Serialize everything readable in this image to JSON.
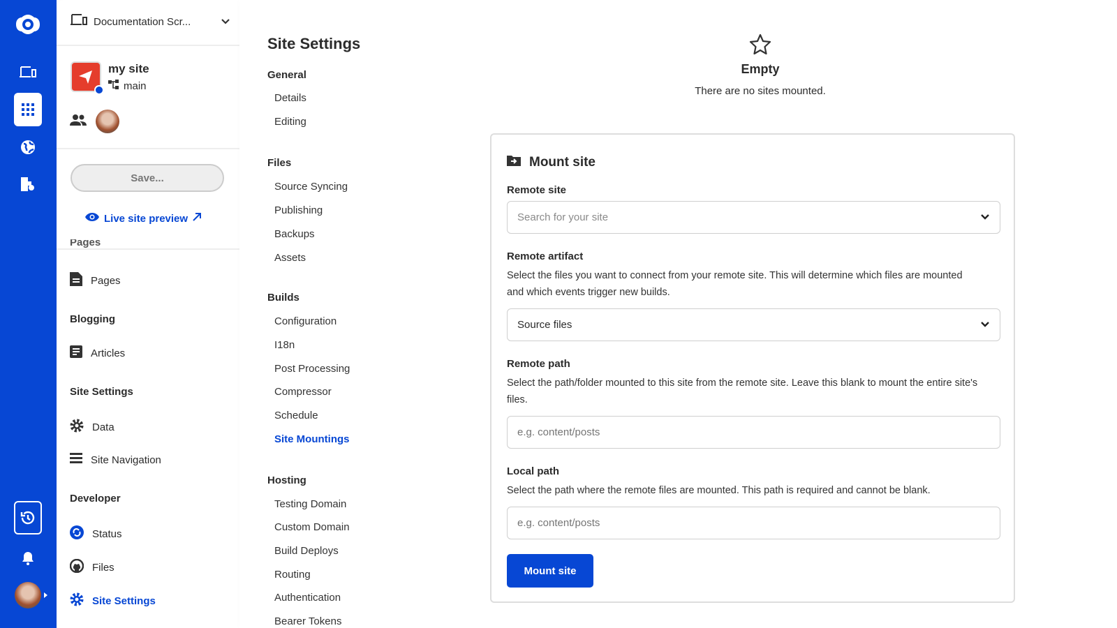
{
  "rail": {
    "brand": "#0747d4"
  },
  "project": {
    "name": "Documentation Scr..."
  },
  "site": {
    "name": "my site",
    "branch": "main"
  },
  "buttons": {
    "save": "Save...",
    "live_preview": "Live site preview"
  },
  "sidebar": {
    "cut_heading": "Pages",
    "sections": [
      {
        "heading": "",
        "items": [
          {
            "label": "Pages",
            "icon": "document-icon"
          }
        ]
      },
      {
        "heading": "Blogging",
        "items": [
          {
            "label": "Articles",
            "icon": "article-icon"
          }
        ]
      },
      {
        "heading": "Site Settings",
        "items": [
          {
            "label": "Data",
            "icon": "gear-icon"
          },
          {
            "label": "Site Navigation",
            "icon": "menu-icon"
          }
        ]
      },
      {
        "heading": "Developer",
        "items": [
          {
            "label": "Status",
            "icon": "sync-icon"
          },
          {
            "label": "Files",
            "icon": "github-icon"
          },
          {
            "label": "Site Settings",
            "icon": "gear-icon",
            "active": true
          }
        ]
      }
    ]
  },
  "settings_nav": {
    "title": "Site Settings",
    "groups": [
      {
        "heading": "General",
        "items": [
          "Details",
          "Editing"
        ]
      },
      {
        "heading": "Files",
        "items": [
          "Source Syncing",
          "Publishing",
          "Backups",
          "Assets"
        ]
      },
      {
        "heading": "Builds",
        "items": [
          "Configuration",
          "I18n",
          "Post Processing",
          "Compressor",
          "Schedule",
          "Site Mountings"
        ]
      },
      {
        "heading": "Hosting",
        "items": [
          "Testing Domain",
          "Custom Domain",
          "Build Deploys",
          "Routing",
          "Authentication",
          "Bearer Tokens"
        ]
      }
    ],
    "active": "Site Mountings"
  },
  "empty": {
    "title": "Empty",
    "text": "There are no sites mounted."
  },
  "form": {
    "title": "Mount site",
    "remote_site": {
      "label": "Remote site",
      "placeholder": "Search for your site"
    },
    "remote_artifact": {
      "label": "Remote artifact",
      "desc": "Select the files you want to connect from your remote site. This will determine which files are mounted and which events trigger new builds.",
      "value": "Source files"
    },
    "remote_path": {
      "label": "Remote path",
      "desc": "Select the path/folder mounted to this site from the remote site. Leave this blank to mount the entire site's files.",
      "placeholder": "e.g. content/posts"
    },
    "local_path": {
      "label": "Local path",
      "desc": "Select the path where the remote files are mounted. This path is required and cannot be blank.",
      "placeholder": "e.g. content/posts"
    },
    "submit": "Mount site"
  }
}
